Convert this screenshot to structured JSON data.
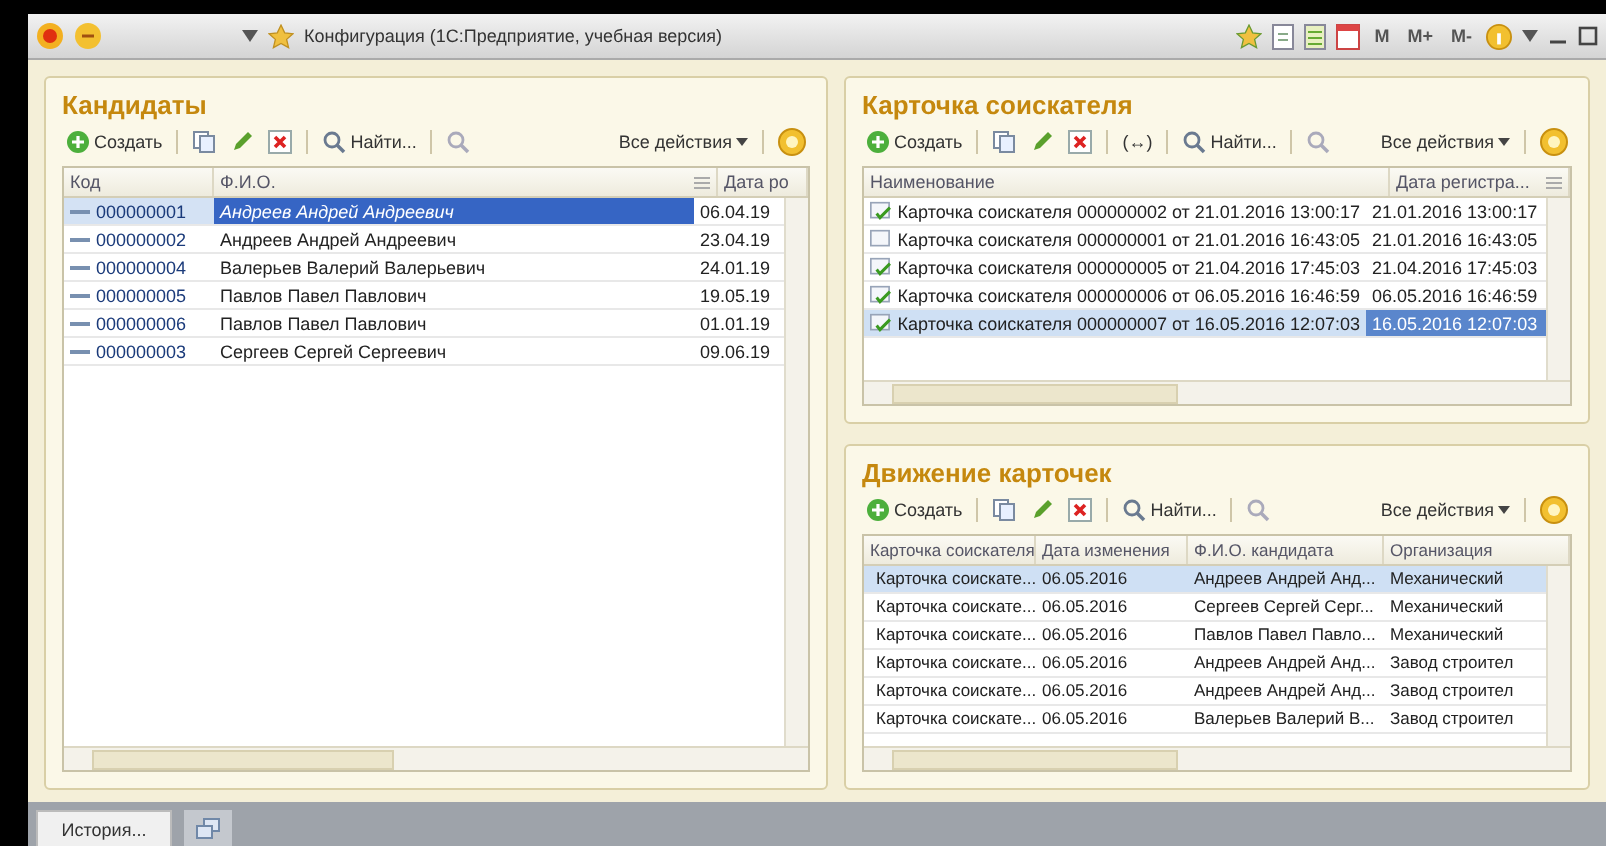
{
  "window": {
    "title": "Конфигурация  (1С:Предприятие, учебная версия)",
    "memory_buttons": [
      "M",
      "M+",
      "M-"
    ]
  },
  "candidates": {
    "title": "Кандидаты",
    "toolbar": {
      "create": "Создать",
      "find": "Найти...",
      "all_actions": "Все действия"
    },
    "columns": [
      "Код",
      "Ф.И.О.",
      "Дата ро"
    ],
    "rows": [
      {
        "code": "000000001",
        "name": "Андреев Андрей Андреевич",
        "date": "06.04.19",
        "selected": true
      },
      {
        "code": "000000002",
        "name": "Андреев Андрей Андреевич",
        "date": "23.04.19",
        "selected": false
      },
      {
        "code": "000000004",
        "name": "Валерьев Валерий Валерьевич",
        "date": "24.01.19",
        "selected": false
      },
      {
        "code": "000000005",
        "name": "Павлов Павел Павлович",
        "date": "19.05.19",
        "selected": false
      },
      {
        "code": "000000006",
        "name": "Павлов Павел Павлович",
        "date": "01.01.19",
        "selected": false
      },
      {
        "code": "000000003",
        "name": "Сергеев Сергей Сергеевич",
        "date": "09.06.19",
        "selected": false
      }
    ]
  },
  "cards": {
    "title": "Карточка соискателя",
    "toolbar": {
      "create": "Создать",
      "link": "(↔)",
      "find": "Найти...",
      "all_actions": "Все действия"
    },
    "columns": [
      "Наименование",
      "Дата регистра..."
    ],
    "rows": [
      {
        "name": "Карточка соискателя 000000002 от 21.01.2016 13:00:17",
        "date": "21.01.2016 13:00:17",
        "posted": true,
        "selected": false
      },
      {
        "name": "Карточка соискателя 000000001 от 21.01.2016 16:43:05",
        "date": "21.01.2016 16:43:05",
        "posted": false,
        "selected": false
      },
      {
        "name": "Карточка соискателя 000000005 от 21.04.2016 17:45:03",
        "date": "21.04.2016 17:45:03",
        "posted": true,
        "selected": false
      },
      {
        "name": "Карточка соискателя 000000006 от 06.05.2016 16:46:59",
        "date": "06.05.2016 16:46:59",
        "posted": true,
        "selected": false
      },
      {
        "name": "Карточка соискателя 000000007 от 16.05.2016 12:07:03",
        "date": "16.05.2016 12:07:03",
        "posted": true,
        "selected": true
      }
    ]
  },
  "movements": {
    "title": "Движение карточек",
    "toolbar": {
      "create": "Создать",
      "find": "Найти...",
      "all_actions": "Все действия"
    },
    "columns": [
      "Карточка соискателя",
      "Дата изменения",
      "Ф.И.О. кандидата",
      "Организация"
    ],
    "rows": [
      {
        "cells": [
          "Карточка соискате...",
          "06.05.2016",
          "Андреев Андрей Анд...",
          "Механический"
        ],
        "selected": true
      },
      {
        "cells": [
          "Карточка соискате...",
          "06.05.2016",
          "Сергеев Сергей Серг...",
          "Механический"
        ],
        "selected": false
      },
      {
        "cells": [
          "Карточка соискате...",
          "06.05.2016",
          "Павлов Павел Павло...",
          "Механический"
        ],
        "selected": false
      },
      {
        "cells": [
          "Карточка соискате...",
          "06.05.2016",
          "Андреев Андрей Анд...",
          "Завод строител"
        ],
        "selected": false
      },
      {
        "cells": [
          "Карточка соискате...",
          "06.05.2016",
          "Андреев Андрей Анд...",
          "Завод строител"
        ],
        "selected": false
      },
      {
        "cells": [
          "Карточка соискате...",
          "06.05.2016",
          "Валерьев Валерий В...",
          "Завод строител"
        ],
        "selected": false
      }
    ]
  },
  "bottom_bar": {
    "history": "История..."
  }
}
